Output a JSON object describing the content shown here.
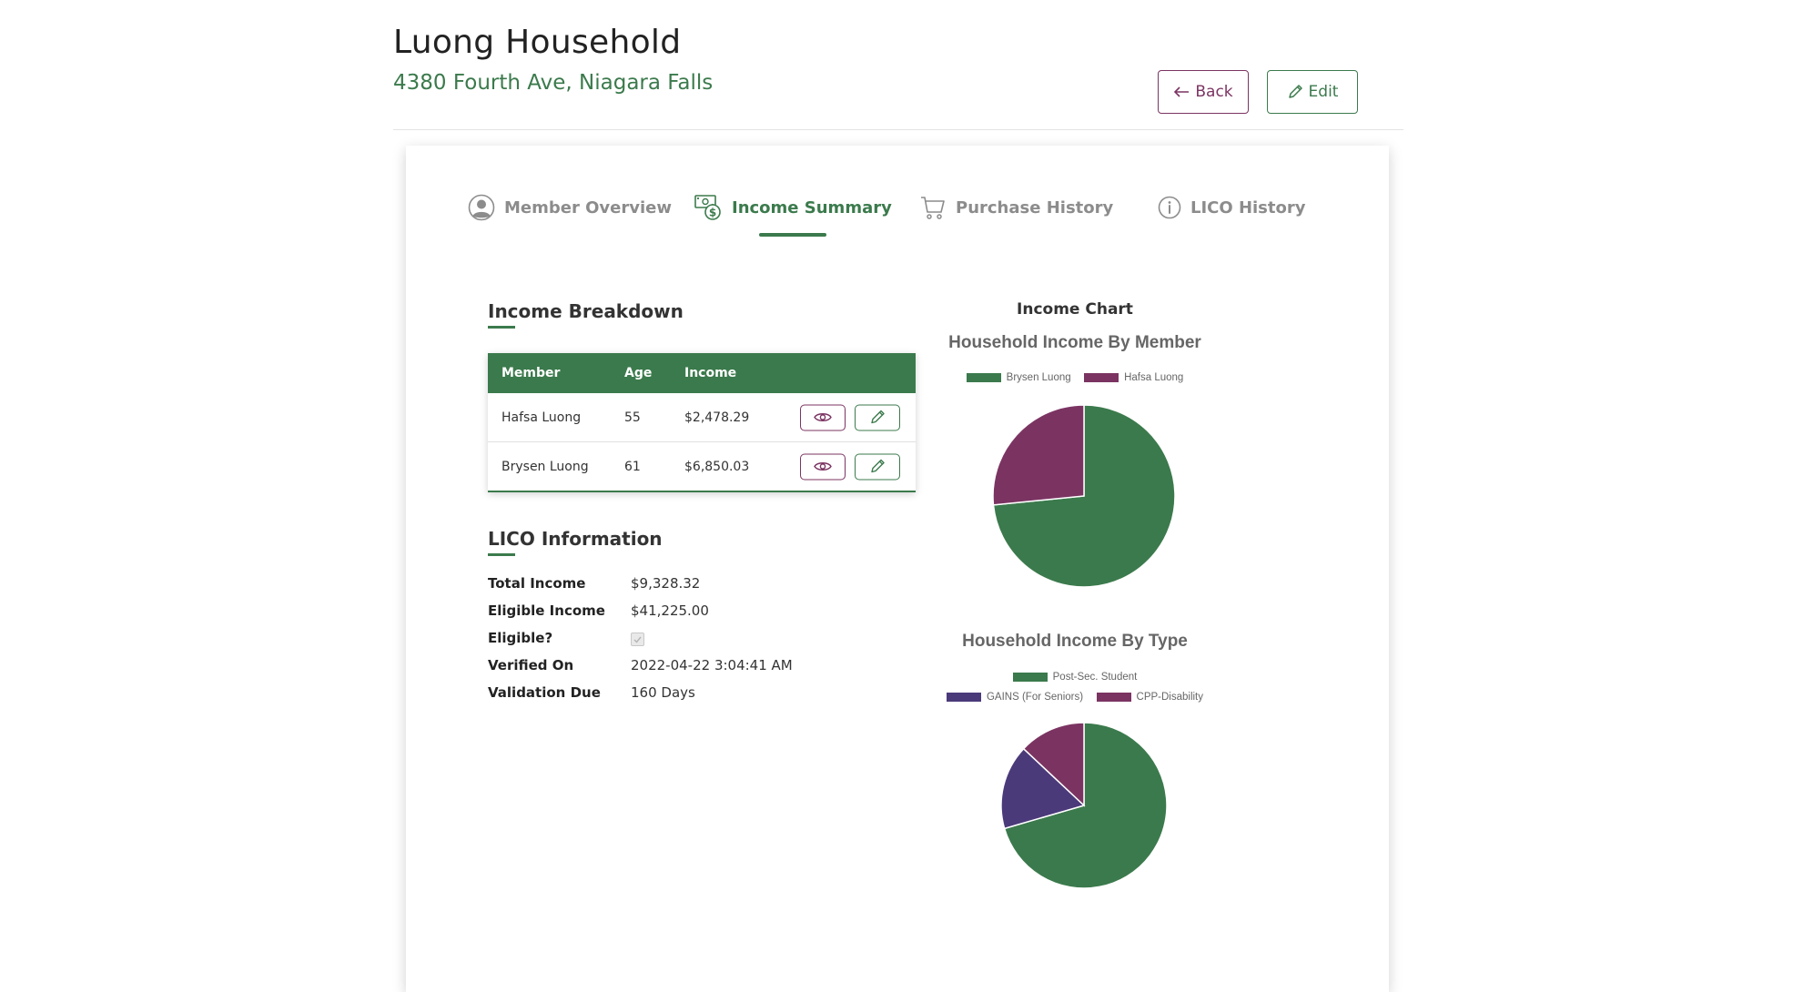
{
  "household": {
    "title": "Luong Household",
    "address": "4380 Fourth Ave, Niagara Falls"
  },
  "header_buttons": {
    "back": "Back",
    "edit": "Edit"
  },
  "tabs": [
    {
      "label": "Member Overview",
      "icon": "user-circle-icon",
      "active": false
    },
    {
      "label": "Income Summary",
      "icon": "money-icon",
      "active": true
    },
    {
      "label": "Purchase History",
      "icon": "cart-icon",
      "active": false
    },
    {
      "label": "LICO History",
      "icon": "info-icon",
      "active": false
    }
  ],
  "income_breakdown": {
    "title": "Income Breakdown",
    "columns": [
      "Member",
      "Age",
      "Income"
    ],
    "rows": [
      {
        "member": "Hafsa Luong",
        "age": "55",
        "income": "$2,478.29"
      },
      {
        "member": "Brysen Luong",
        "age": "61",
        "income": "$6,850.03"
      }
    ]
  },
  "lico_information": {
    "title": "LICO Information",
    "total_income_label": "Total Income",
    "total_income": "$9,328.32",
    "eligible_income_label": "Eligible Income",
    "eligible_income": "$41,225.00",
    "eligible_label": "Eligible?",
    "eligible": true,
    "verified_on_label": "Verified On",
    "verified_on": "2022-04-22 3:04:41 AM",
    "validation_due_label": "Validation Due",
    "validation_due": "160 Days"
  },
  "income_chart_label": "Income Chart",
  "colors": {
    "green": "#3b7a4c",
    "plum": "#7b3462",
    "purple": "#4b3a7a"
  },
  "chart_data": [
    {
      "type": "pie",
      "title": "Household Income By Member",
      "labels": [
        "Brysen Luong",
        "Hafsa Luong"
      ],
      "values": [
        6850.03,
        2478.29
      ],
      "colors": [
        "#3b7a4c",
        "#7b3462"
      ],
      "legend": "top"
    },
    {
      "type": "pie",
      "title": "Household Income By Type",
      "labels": [
        "Post-Sec. Student",
        "GAINS (For Seniors)",
        "CPP-Disability"
      ],
      "values": [
        70.5,
        16.5,
        13
      ],
      "colors": [
        "#3b7a4c",
        "#4b3a7a",
        "#7b3462"
      ],
      "legend": "top"
    }
  ]
}
